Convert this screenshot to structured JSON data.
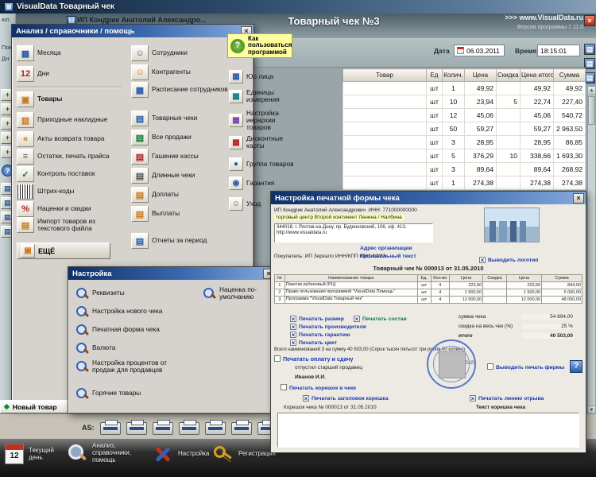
{
  "icons": {
    "grid": "▦",
    "page": "▤",
    "box": "▣",
    "stripes": "▥",
    "smiley": "☺",
    "target": "◉",
    "dot": "●",
    "diamond": "◆",
    "back": "«",
    "lines": "≡",
    "check": "✓",
    "percent": "%",
    "days": "12",
    "more": "…",
    "question": "?",
    "close": "×",
    "up": "▲",
    "down": "▼",
    "plus": "+"
  },
  "titlebar": {
    "title": "VisualData Товарный чек"
  },
  "header": {
    "doc_window_title": "ИП Кондрик Анатолий Александро...",
    "receipt_header": "Товарный чек №3",
    "site": ">>> www.VisualData.ru",
    "version": "Версия программы 7.11.0",
    "date_label": "Дата",
    "date_value": "06.03.2011",
    "time_label": "Время",
    "time_value": "18:15:01"
  },
  "left_strip": {
    "f1": "юп.",
    "f2": "Покупа",
    "f3": "Дн"
  },
  "table": {
    "headers": [
      "Товар",
      "Ед",
      "Колич.",
      "Цена",
      "Скидка %",
      "Цена итоговая",
      "Сумма"
    ],
    "rows": [
      [
        "",
        "шт",
        "1",
        "49,92",
        "",
        "49,92",
        "49,92"
      ],
      [
        "",
        "шт",
        "10",
        "23,94",
        "5",
        "22,74",
        "227,40"
      ],
      [
        "",
        "шт",
        "12",
        "45,06",
        "",
        "45,06",
        "540,72"
      ],
      [
        "",
        "шт",
        "50",
        "59,27",
        "",
        "59,27",
        "2 963,50"
      ],
      [
        "",
        "шт",
        "3",
        "28,95",
        "",
        "28,95",
        "86,85"
      ],
      [
        "",
        "шт",
        "5",
        "376,29",
        "10",
        "338,66",
        "1 693,30"
      ],
      [
        "",
        "шт",
        "3",
        "89,64",
        "",
        "89,64",
        "268,92"
      ],
      [
        "",
        "шт",
        "1",
        "274,38",
        "",
        "274,38",
        "274,38"
      ]
    ]
  },
  "menu": {
    "title": "Анализ / справочники / помощь",
    "col1": [
      "Месяца",
      "Дни",
      "Товары",
      "Приходные накладные",
      "Акты возврата товара",
      "Остатки, печать прайса",
      "Контроль поставок",
      "Штрих-коды",
      "Наценки и скидки",
      "Импорт товаров из текстового файла",
      "ЕЩЁ"
    ],
    "col2": [
      "Сотрудники",
      "Контрагенты",
      "Расписание сотрудников",
      "Товарные чеки",
      "Все продажи",
      "Гашение кассы",
      "Длинные чеки",
      "Доплаты",
      "Выплаты",
      "Отчеты за период"
    ],
    "help": "Как пользоваться программой",
    "col3": [
      "Юр лица",
      "Единицы измерения",
      "Настройка иерархии товаров",
      "Дисконтные карты",
      "Группа товаров",
      "Гарантия",
      "Уход"
    ]
  },
  "settings": {
    "title": "Настройка",
    "items": [
      "Реквизиты",
      "Настройка нового чека",
      "Печатная форма чека",
      "Валюта",
      "Настройка процентов от продаж для продавцов",
      "Горячие товары"
    ],
    "default_markup": "Наценка по-умолчанию"
  },
  "print": {
    "title": "Настройка печатной формы чека",
    "company_name": "ИП Кондрик Анатолий Александрович",
    "inn": "ИНН: 771000000000",
    "company_line2": "торговый центр Второй континент Ленина / Налбина",
    "address": "344018, г. Ростов-на-Дону, пр. Буденновский, 106, оф. 413, http://www.visualdata.ru",
    "address_label": "Адрес организации",
    "custom_text_label": "Произвольный текст",
    "buyer": "Покупатель:  ИП Зеркало  ИНН/КПП 6161 12/23",
    "logo_checkbox": "Выводить логотип",
    "receipt_no": "Товарный чек № 000013 от 31.05.2010",
    "items_table": {
      "headers": [
        "№",
        "Наименование товара",
        "Ед.",
        "Кол-во",
        "Цена",
        "Скидка",
        "Цена",
        "Сумма"
      ],
      "rows": [
        [
          "1",
          "Пакетик рубиновый (РЦ)",
          "шт",
          "4",
          "223,50",
          "",
          "223,50",
          "894,00"
        ],
        [
          "2",
          "Право пользования программой \"VisualData Помощь\"",
          "шт",
          "4",
          "1 500,00",
          "",
          "1 500,00",
          "6 000,00"
        ],
        [
          "3",
          "Программа \"VisualData Товарный чек\"",
          "шт",
          "4",
          "12 000,00",
          "",
          "12 000,00",
          "48 000,00"
        ]
      ]
    },
    "cb_size": "Печатать размер",
    "cb_composition": "Печатать состав",
    "cb_manufacturer": "Печатать производителя",
    "cb_warranty": "Печатать гарантию",
    "cb_color": "Печатать цвет",
    "sum_label": "сумма чека",
    "sum_value": "54 894,00",
    "discount_label": "скидка на весь чек (%)",
    "discount_value": "25 %",
    "total_label": "итого",
    "total_value": "40 503,00",
    "total_line": "Всего наименований 3 на сумму 40 503,00 (Сорок тысяч пятьсот три рубля 00 копеек)",
    "cb_payment": "Печатать оплату и сдачу",
    "released_by": "отпустил старший продавец",
    "seller_name": "Иванов И.И.",
    "date_text": "31 мая 2010",
    "cb_stamp": "Выводить печать фирмы",
    "cb_stub": "Печатать корешок в чеке",
    "cb_stub_header": "Печатать заголовок корешка",
    "cb_tear_line": "Печатать линию отрыва",
    "stub_no": "Корешок чека № 000013 от 31.05.2010",
    "stub_text_label": "Текст корешка чека"
  },
  "bottom": {
    "new_item": "Новый товар",
    "as_label": "AS:",
    "taskbar": [
      "Текущий день",
      "Анализ, справочники, помощь",
      "Настройка",
      "Регистрация"
    ]
  }
}
